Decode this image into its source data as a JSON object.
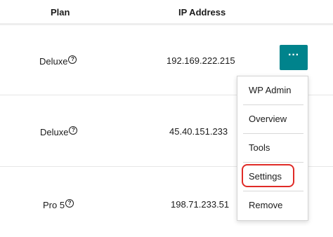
{
  "table": {
    "headers": {
      "plan": "Plan",
      "ip_address": "IP Address"
    },
    "rows": [
      {
        "plan": "Deluxe",
        "ip_address": "192.169.222.215"
      },
      {
        "plan": "Deluxe",
        "ip_address": "45.40.151.233"
      },
      {
        "plan": "Pro 5",
        "ip_address": "198.71.233.51"
      }
    ]
  },
  "actions": {
    "more_label": "···"
  },
  "help_glyph": "?",
  "menu": {
    "items": [
      {
        "label": "WP Admin"
      },
      {
        "label": "Overview"
      },
      {
        "label": "Tools"
      },
      {
        "label": "Settings"
      },
      {
        "label": "Remove"
      }
    ]
  },
  "colors": {
    "accent": "#00838c",
    "highlight": "#e02b27"
  }
}
